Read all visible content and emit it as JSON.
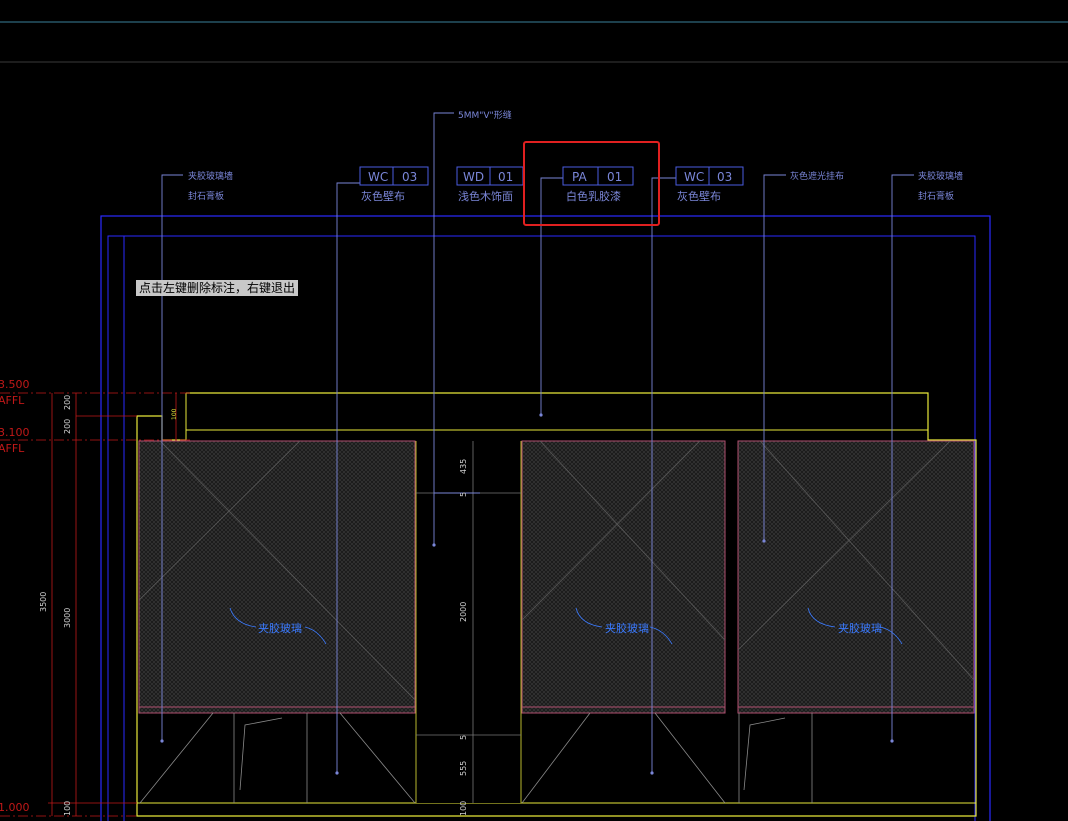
{
  "colors": {
    "background": "#000000",
    "frame_blue": "#2a2aff",
    "annotation_blue": "#7a86d8",
    "tag_blue": "#4a5de0",
    "yellow": "#e8e83a",
    "red_dim": "#c01818",
    "highlight_red": "#e02020",
    "glass_pink": "#b05070"
  },
  "tooltip": {
    "text": "点击左键删除标注，右键退出"
  },
  "callouts": {
    "top": "5MM\"V\"形缝",
    "left_line1": "夹胶玻璃墙",
    "left_line2": "封石膏板",
    "right_line1": "夹胶玻璃墙",
    "right_line2": "封石膏板",
    "grey_cloth": "灰色遮光挂布"
  },
  "tags": [
    {
      "code": "WC",
      "num": "03",
      "desc": "灰色壁布"
    },
    {
      "code": "WD",
      "num": "01",
      "desc": "浅色木饰面"
    },
    {
      "code": "PA",
      "num": "01",
      "desc": "白色乳胶漆"
    },
    {
      "code": "WC",
      "num": "03",
      "desc": "灰色壁布"
    }
  ],
  "levels": {
    "l1_value": "3.500",
    "l1_unit": "AFFL",
    "l2_value": "3.100",
    "l2_unit": "AFFL",
    "l3_value": "1.000"
  },
  "dims_left": {
    "d200a": "200",
    "d200b": "200",
    "d3500": "3500",
    "d3000": "3000",
    "d100": "100",
    "d100b": "100"
  },
  "dims_door": {
    "d435": "435",
    "d5a": "5",
    "d2000": "2000",
    "d5b": "5",
    "d555": "555",
    "d100": "100"
  },
  "glass_labels": [
    "夹胶玻璃",
    "夹胶玻璃",
    "夹胶玻璃"
  ]
}
